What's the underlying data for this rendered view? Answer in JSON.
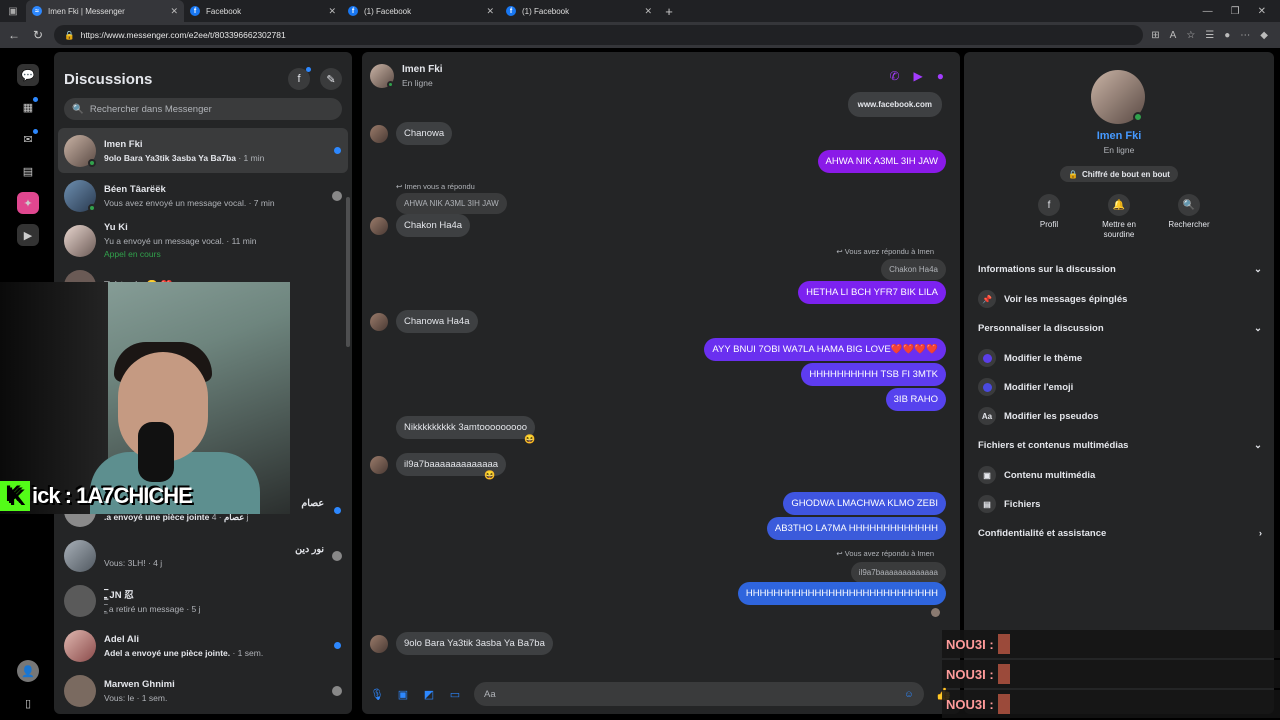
{
  "browser": {
    "tabs": [
      {
        "label": "Imen Fki | Messenger",
        "icon": "messenger-icon"
      },
      {
        "label": "Facebook",
        "icon": "facebook-icon"
      },
      {
        "label": "(1) Facebook",
        "icon": "facebook-icon"
      },
      {
        "label": "(1) Facebook",
        "icon": "facebook-icon"
      }
    ],
    "url": "https://www.messenger.com/e2ee/t/803396662302781"
  },
  "chats": {
    "title": "Discussions",
    "search_placeholder": "Rechercher dans Messenger",
    "items": [
      {
        "name": "Imen Fki",
        "preview": "9olo Bara Ya3tik 3asba Ya Ba7ba",
        "time": " · 1 min",
        "unread": true
      },
      {
        "name": "Béen Tâarëëk",
        "preview": "Vous avez envoyé un message vocal.",
        "time": " · 7 min"
      },
      {
        "name": "Yu Ki",
        "preview": "Yu a envoyé un message vocal.",
        "time": " · 11 min",
        "extra": "Appel en cours"
      },
      {
        "name": "Tahtouha😊 ❤️",
        "preview": "",
        "time": ""
      },
      {
        "name": "عصام",
        "preview": ".a envoyé une pièce jointe عصام",
        "time": " · 4 j",
        "unread": true
      },
      {
        "name": "نور دين",
        "preview": "Vous: 3LH!",
        "time": " · 4 j"
      },
      {
        "name": "ـ̷͟͞ JN 忍",
        "preview": "ـ̷͟͞ a retiré un message",
        "time": " · 5 j"
      },
      {
        "name": "Adel Ali",
        "preview": "Adel a envoyé une pièce jointe.",
        "time": " · 1 sem.",
        "unread": true
      },
      {
        "name": "Marwen Ghnimi",
        "preview": "Vous: le",
        "time": " · 1 sem."
      }
    ]
  },
  "conversation": {
    "name": "Imen Fki",
    "status": "En ligne",
    "top_link": "www.facebook.com",
    "messages": {
      "m1": "Chanowa",
      "m2": "AHWA NIK A3ML 3IH JAW",
      "m3_reply_label": "Imen vous a répondu",
      "m3_quote": "AHWA NIK A3ML 3IH JAW",
      "m3": "Chakon Ha4a",
      "m4_reply_label": "Vous avez répondu à Imen",
      "m4_quote": "Chakon Ha4a",
      "m4": "HETHA LI BCH YFR7 BIK LILA",
      "m5": "Chanowa Ha4a",
      "m6": "AYY BNUI 7OBI WA7LA HAMA BIG LOVE❤️❤️❤️❤️",
      "m7": "HHHHHHHHHH TSB FI 3MTK",
      "m8": "3IB RAHO",
      "m9": "Nikkkkkkkkk 3amtooooooooo",
      "m10": "il9a7baaaaaaaaaaaaa",
      "m11": "GHODWA LMACHWA KLMO ZEBI",
      "m12": "AB3THO LA7MA HHHHHHHHHHHHH",
      "m13_reply_label": "Vous avez répondu à Imen",
      "m13_quote": "il9a7baaaaaaaaaaaaa",
      "m13": "HHHHHHHHHHHHHHHHHHHHHHHHHHHH",
      "m14": "9olo Bara Ya3tik 3asba Ya Ba7ba"
    },
    "input_placeholder": "Aa"
  },
  "info": {
    "name": "Imen Fki",
    "status": "En ligne",
    "encryption": "Chiffré de bout en bout",
    "actions": [
      {
        "label": "Profil",
        "icon": "facebook-icon"
      },
      {
        "label": "Mettre en sourdine",
        "icon": "bell-icon"
      },
      {
        "label": "Rechercher",
        "icon": "search-icon"
      }
    ],
    "sections": {
      "about": "Informations sur la discussion",
      "pinned": "Voir les messages épinglés",
      "customize": "Personnaliser la discussion",
      "theme": "Modifier le thème",
      "emoji": "Modifier l'emoji",
      "nicknames": "Modifier les pseudos",
      "media_section": "Fichiers et contenus multimédias",
      "media": "Contenu multimédia",
      "files": "Fichiers",
      "privacy": "Confidentialité et assistance"
    }
  },
  "overlay": {
    "kick_label": "ick : 1A7CHICHE",
    "chat_lines": [
      "NOU3I :",
      "NOU3I :",
      "NOU3I :"
    ]
  },
  "colors": {
    "accent_purple": "#a33cff",
    "bubble_purple": "#8a1ae8",
    "bubble_blue": "#3b5bdb",
    "messenger_blue": "#2d88ff",
    "online_green": "#31a24c"
  }
}
